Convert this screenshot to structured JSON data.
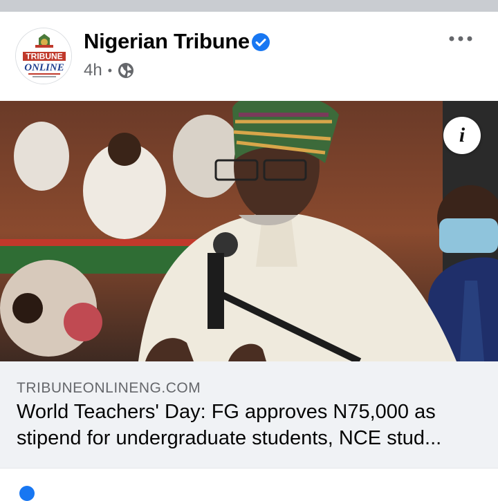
{
  "post": {
    "page_name": "Nigerian Tribune",
    "timestamp": "4h",
    "separator": "•",
    "privacy_icon": "globe-icon",
    "verified_icon": "verified-badge-icon",
    "more_icon": "more-options-icon",
    "avatar_logo_text": "TRIBUNE ONLINE"
  },
  "link": {
    "domain": "TRIBUNEONLINENG.COM",
    "headline_line1": "World Teachers' Day: FG approves N75,000 as",
    "headline_line2": "stipend for undergraduate students, NCE stud..."
  },
  "photo": {
    "info_icon_glyph": "i",
    "info_icon": "info-icon"
  },
  "colors": {
    "verified": "#1877f2",
    "card_background": "#f0f2f5",
    "meta_text": "#65676b",
    "title_text": "#050505"
  }
}
